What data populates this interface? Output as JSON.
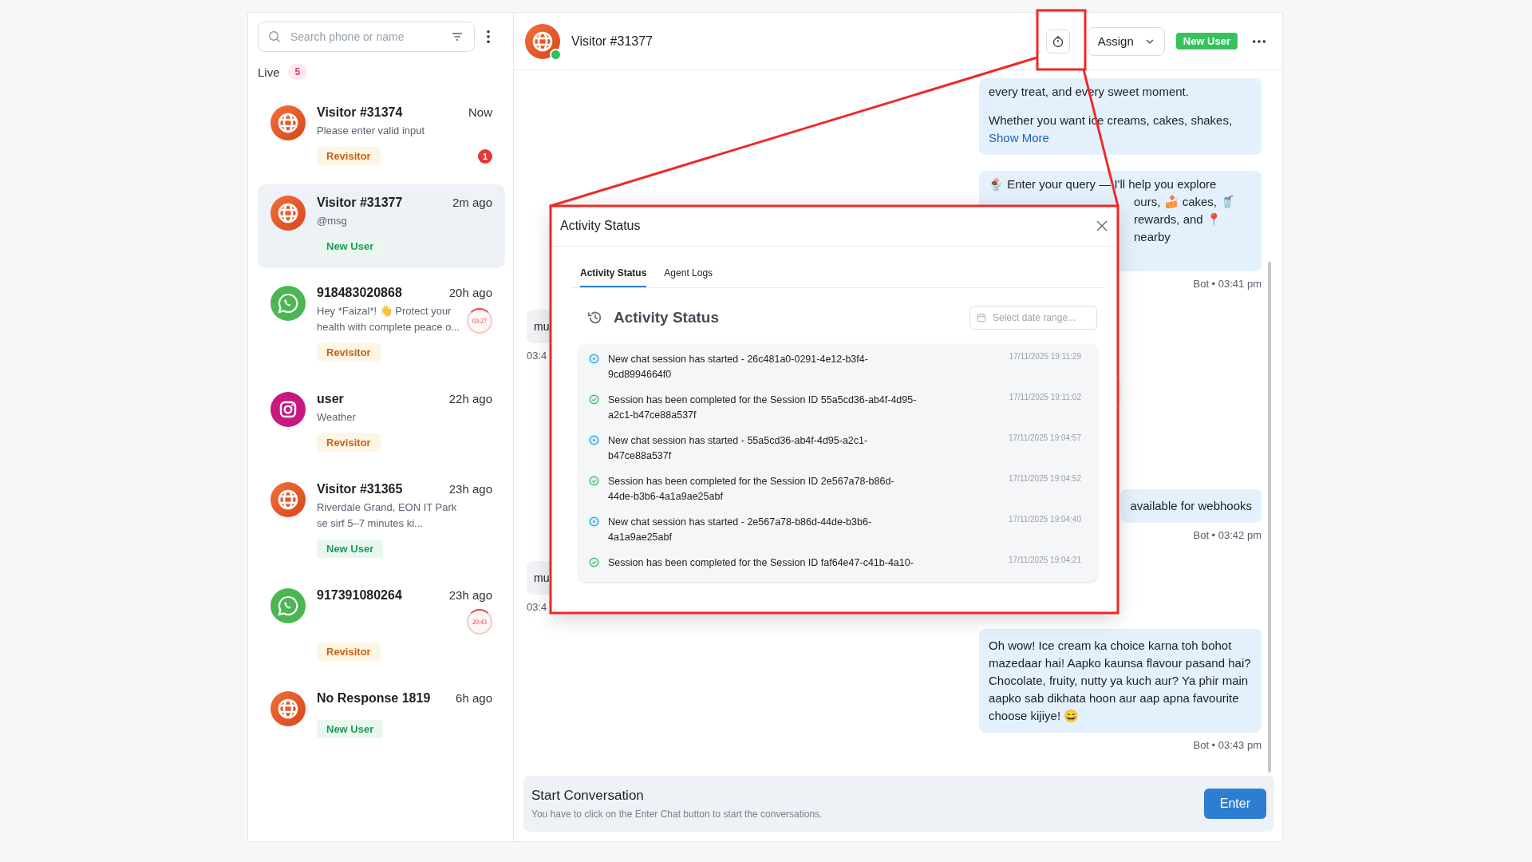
{
  "sidebar": {
    "search": {
      "placeholder": "Search phone or name"
    },
    "live": {
      "label": "Live",
      "count": "5"
    },
    "conversations": [
      {
        "kind": "web",
        "name": "Visitor #31374",
        "time": "Now",
        "preview": "Please enter valid input",
        "tag": {
          "kind": "revisitor",
          "label": "Revisitor"
        },
        "unread": "1",
        "selected": false
      },
      {
        "kind": "web",
        "name": "Visitor #31377",
        "time": "2m ago",
        "preview": "@msg",
        "tag": {
          "kind": "new",
          "label": "New User"
        },
        "selected": true
      },
      {
        "kind": "whatsapp",
        "name": "918483020868",
        "time": "20h ago",
        "preview": "Hey *Faizal*! 👋 Protect your health with complete peace o...",
        "timer": "03:27",
        "tag": {
          "kind": "revisitor",
          "label": "Revisitor"
        },
        "selected": false
      },
      {
        "kind": "instagram",
        "name": "user",
        "time": "22h ago",
        "preview": "Weather",
        "tag": {
          "kind": "revisitor",
          "label": "Revisitor"
        },
        "selected": false
      },
      {
        "kind": "web",
        "name": "Visitor #31365",
        "time": "23h ago",
        "preview": "Riverdale Grand, EON IT Park se sirf 5–7 minutes ki...",
        "tag": {
          "kind": "new",
          "label": "New User"
        },
        "selected": false
      },
      {
        "kind": "whatsapp",
        "name": "917391080264",
        "time": "23h ago",
        "timer": "20:43",
        "tag": {
          "kind": "revisitor",
          "label": "Revisitor"
        },
        "selected": false
      },
      {
        "kind": "web",
        "name": "No Response 1819",
        "time": "6h ago",
        "tag": {
          "kind": "new",
          "label": "New User"
        },
        "selected": false
      }
    ]
  },
  "chat": {
    "header": {
      "kind": "web",
      "online": true,
      "title": "Visitor #31377",
      "assign": "Assign",
      "badge": "New User"
    },
    "messages": [
      {
        "kind": "bot",
        "paragraphs": [
          "every treat, and every sweet moment.",
          "Whether you want ice creams, cakes, shakes,"
        ],
        "link": "Show More"
      },
      {
        "kind": "bot",
        "lines": [
          {
            "text": "🍨 Enter your query — I'll help you explore",
            "clipped": false
          },
          {
            "text": "ours, 🍰 cakes, 🥤",
            "clipped": true
          },
          {
            "text": "rewards, and 📍 nearby",
            "clipped": true
          }
        ],
        "meta": "Bot • 03:41 pm"
      },
      {
        "kind": "user",
        "text": "mu",
        "meta": "03:4"
      },
      {
        "kind": "quick-reply"
      },
      {
        "kind": "bot",
        "text": "available for webhooks",
        "meta": "Bot • 03:42 pm"
      },
      {
        "kind": "user",
        "text": "mu",
        "meta": "03:4"
      },
      {
        "kind": "bot",
        "text": "Oh wow! Ice cream ka choice karna toh bohot mazedaar hai! Aapko kaunsa flavour pasand hai? Chocolate, fruity, nutty ya kuch aur? Ya phir main aapko sab dikhata hoon aur aap apna favourite choose kijiye! 😄",
        "meta": "Bot • 03:43 pm"
      }
    ],
    "composer": {
      "title": "Start Conversation",
      "hint": "You have to click on the Enter Chat button to start the conversations.",
      "button": "Enter"
    }
  },
  "modal": {
    "title": "Activity Status",
    "tabs": [
      {
        "label": "Activity Status",
        "selected": true
      },
      {
        "label": "Agent Logs",
        "selected": false
      }
    ],
    "heading": "Activity Status",
    "date_range": {
      "placeholder": "Select date range..."
    },
    "logs": [
      {
        "kind": "started",
        "text": "New chat session has started - 26c481a0-0291-4e12-b3f4-9cd8994664f0",
        "time": "17/11/2025 19:11:29"
      },
      {
        "kind": "completed",
        "text": "Session has been completed for the Session ID 55a5cd36-ab4f-4d95-a2c1-b47ce88a537f",
        "time": "17/11/2025 19:11:02"
      },
      {
        "kind": "started",
        "text": "New chat session has started - 55a5cd36-ab4f-4d95-a2c1-b47ce88a537f",
        "time": "17/11/2025 19:04:57"
      },
      {
        "kind": "completed",
        "text": "Session has been completed for the Session ID 2e567a78-b86d-44de-b3b6-4a1a9ae25abf",
        "time": "17/11/2025 19:04:52"
      },
      {
        "kind": "started",
        "text": "New chat session has started - 2e567a78-b86d-44de-b3b6-4a1a9ae25abf",
        "time": "17/11/2025 19:04:40"
      },
      {
        "kind": "completed",
        "text": "Session has been completed for the Session ID faf64e47-c41b-4a10-",
        "time": "17/11/2025 19:04:21"
      }
    ]
  }
}
